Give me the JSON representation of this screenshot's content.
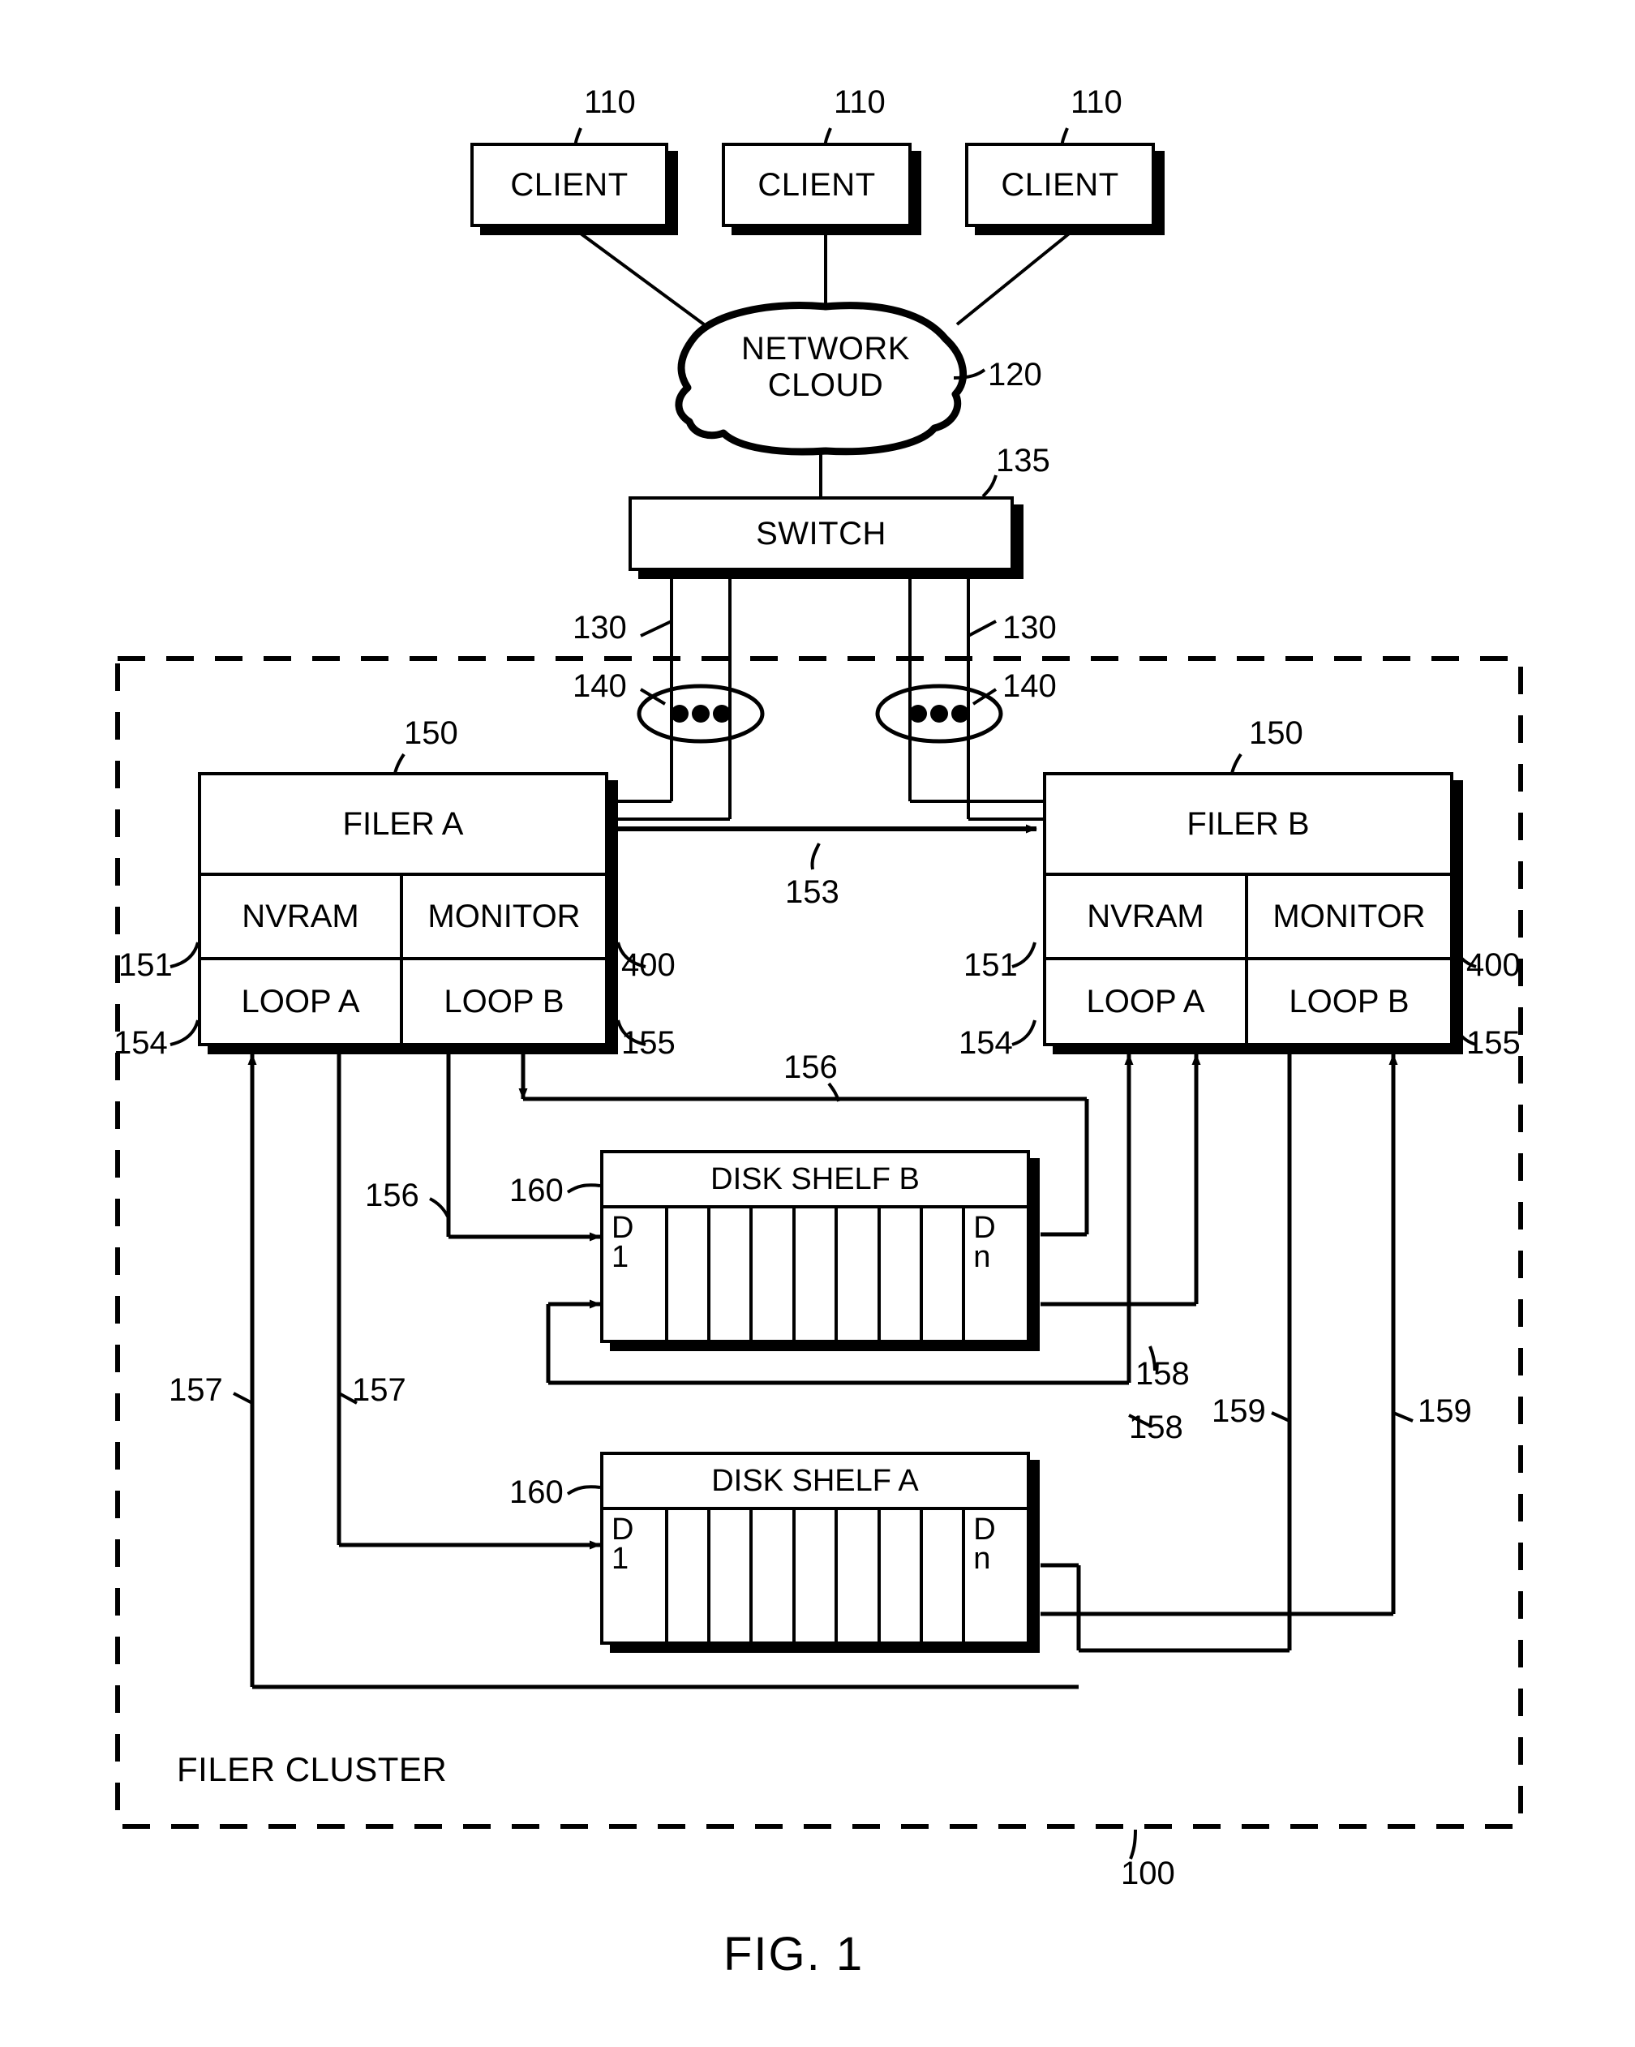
{
  "figure": {
    "caption": "FIG. 1",
    "system_ref": "100",
    "cluster_label": "FILER CLUSTER"
  },
  "clients": [
    {
      "label": "CLIENT",
      "ref": "110"
    },
    {
      "label": "CLIENT",
      "ref": "110"
    },
    {
      "label": "CLIENT",
      "ref": "110"
    }
  ],
  "network": {
    "line1": "NETWORK",
    "line2": "CLOUD",
    "ref": "120"
  },
  "switch": {
    "label": "SWITCH",
    "ref": "135"
  },
  "links": {
    "network_link_left_ref": "130",
    "network_link_right_ref": "130",
    "adapter_left_ref": "140",
    "adapter_right_ref": "140",
    "interconnect_ref": "153"
  },
  "filers": [
    {
      "title": "FILER A",
      "ref": "150",
      "nvram": "NVRAM",
      "monitor": "MONITOR",
      "loop_a": "LOOP A",
      "loop_b": "LOOP B",
      "nvram_ref": "151",
      "monitor_ref": "400",
      "loop_a_ref": "154",
      "loop_b_ref": "155"
    },
    {
      "title": "FILER B",
      "ref": "150",
      "nvram": "NVRAM",
      "monitor": "MONITOR",
      "loop_a": "LOOP A",
      "loop_b": "LOOP B",
      "nvram_ref": "151",
      "monitor_ref": "400",
      "loop_a_ref": "154",
      "loop_b_ref": "155"
    }
  ],
  "disk_shelves": [
    {
      "title": "DISK SHELF B",
      "ref": "160",
      "first_disk_line1": "D",
      "first_disk_line2": "1",
      "last_disk_line1": "D",
      "last_disk_line2": "n",
      "disk_count": 9
    },
    {
      "title": "DISK SHELF A",
      "ref": "160",
      "first_disk_line1": "D",
      "first_disk_line2": "1",
      "last_disk_line1": "D",
      "last_disk_line2": "n",
      "disk_count": 9
    }
  ],
  "loop_refs": {
    "a_left_upper": "156",
    "a_left_lower": "156",
    "b_left_upper": "157",
    "b_left_lower": "157",
    "right_upper": "158",
    "right_lower": "158",
    "far_right_upper": "159",
    "far_right_lower": "159"
  }
}
